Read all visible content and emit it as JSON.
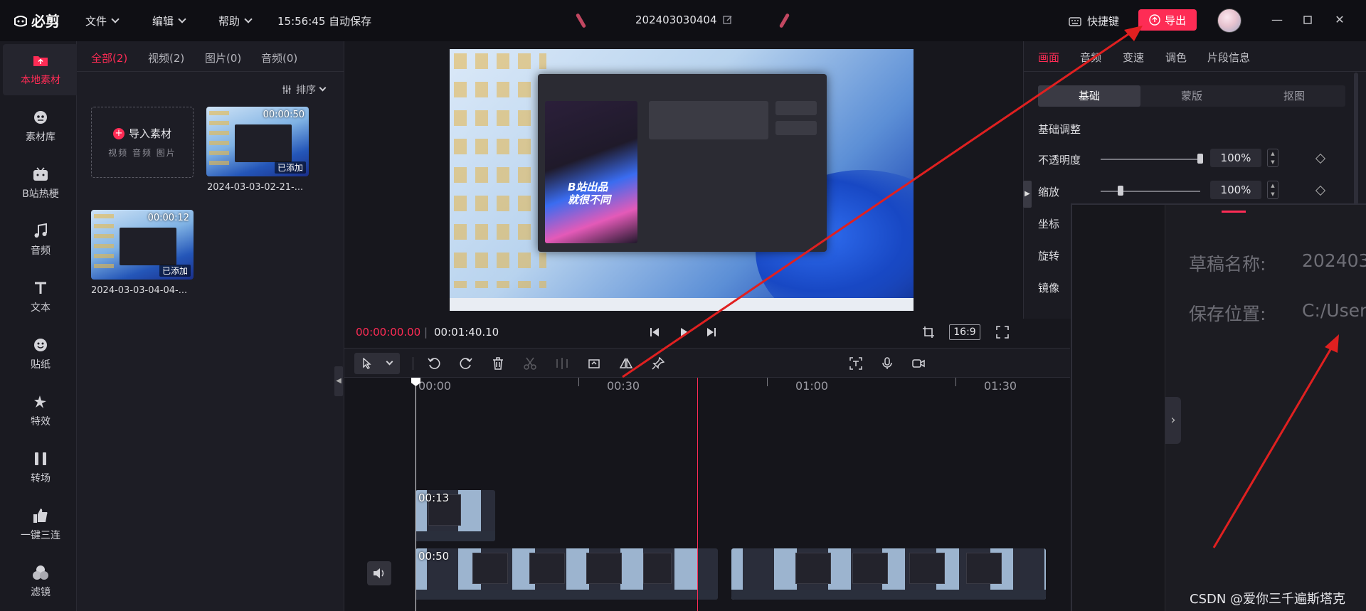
{
  "app": {
    "logo": "必剪",
    "menus": [
      "文件",
      "编辑",
      "帮助"
    ],
    "autosave": "15:56:45 自动保存",
    "project_name": "202403030404",
    "shortcut_label": "快捷键",
    "export_label": "导出"
  },
  "sidebar": {
    "items": [
      {
        "label": "本地素材",
        "icon": "upload-folder-icon",
        "active": true
      },
      {
        "label": "素材库",
        "icon": "cube-icon"
      },
      {
        "label": "B站热梗",
        "icon": "tv-icon"
      },
      {
        "label": "音频",
        "icon": "music-note-icon"
      },
      {
        "label": "文本",
        "icon": "text-icon"
      },
      {
        "label": "贴纸",
        "icon": "sticker-icon"
      },
      {
        "label": "特效",
        "icon": "sparkle-icon"
      },
      {
        "label": "转场",
        "icon": "transition-icon"
      },
      {
        "label": "一键三连",
        "icon": "thumbs-up-icon"
      },
      {
        "label": "滤镜",
        "icon": "filter-icon"
      }
    ]
  },
  "media": {
    "tabs": [
      "全部(2)",
      "视频(2)",
      "图片(0)",
      "音频(0)"
    ],
    "sort_label": "排序",
    "import_label": "导入素材",
    "import_sub": "视频 音频 图片",
    "items": [
      {
        "duration": "00:00:50",
        "badge": "已添加",
        "name": "2024-03-03-02-21-..."
      },
      {
        "duration": "00:00:12",
        "badge": "已添加",
        "name": "2024-03-03-04-04-..."
      }
    ]
  },
  "preview": {
    "dialog_art_text": "B站出品\n就很不同",
    "current_time": "00:00:00.00",
    "separator": "|",
    "total_time": "00:01:40.10",
    "aspect_ratio": "16:9"
  },
  "right_panel": {
    "tabs": [
      "画面",
      "音频",
      "变速",
      "调色",
      "片段信息"
    ],
    "subtabs": [
      "基础",
      "蒙版",
      "抠图"
    ],
    "section_title": "基础调整",
    "opacity": {
      "label": "不透明度",
      "value": "100%",
      "level": 1.0
    },
    "scale": {
      "label": "缩放",
      "value": "100%",
      "level": 0.2
    },
    "position_label": "坐标",
    "rotation_label": "旋转",
    "mirror_label": "镜像"
  },
  "timeline": {
    "ruler": [
      "00:00",
      "00:30",
      "01:00",
      "01:30"
    ],
    "clips": [
      {
        "duration": "00:13"
      },
      {
        "duration": "00:50"
      }
    ]
  },
  "zoom_overlay": {
    "draft_label": "草稿名称:",
    "draft_value": "202403",
    "save_label": "保存位置:",
    "save_value": "C:/User"
  },
  "watermark": "CSDN @爱你三千遍斯塔克",
  "colors": {
    "accent": "#fe2c55",
    "annotation_arrow": "#e02020",
    "bg": "#17171d"
  }
}
